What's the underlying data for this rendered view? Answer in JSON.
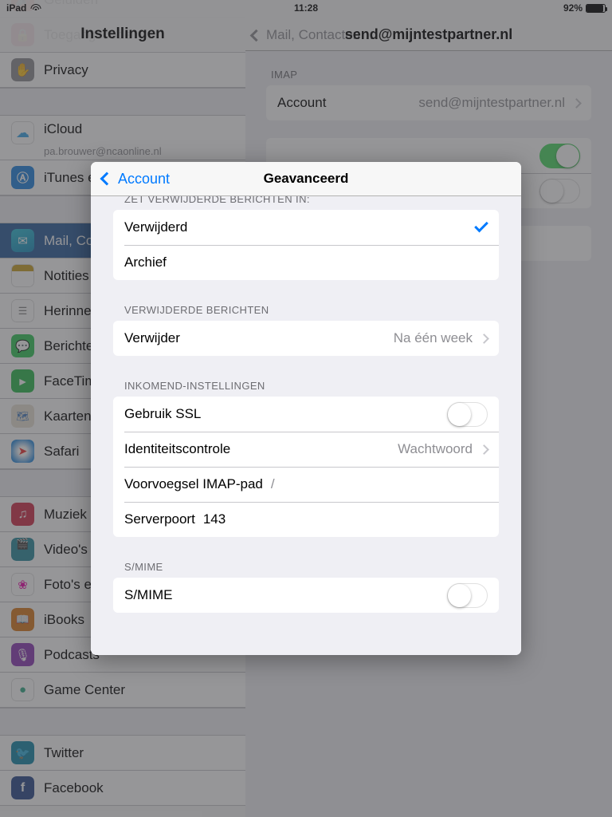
{
  "statusbar": {
    "device": "iPad",
    "wifi_icon": "wifi-icon",
    "time": "11:28",
    "battery_percent": "92%",
    "battery_icon": "battery-icon"
  },
  "sidebar": {
    "nav_title": "Instellingen",
    "items": [
      {
        "label": "Geluiden",
        "icon": "speaker-icon",
        "color": "#ef4a3c",
        "selected": false,
        "partial": true
      },
      {
        "label": "Toegangscode",
        "icon": "lock-icon",
        "color": "#c9233f",
        "selected": false
      },
      {
        "label": "Privacy",
        "icon": "hand-icon",
        "color": "#8e8e93",
        "selected": false
      },
      {
        "label": "iCloud",
        "sublabel": "pa.brouwer@ncaonline.nl",
        "icon": "icloud-icon",
        "color": "#3aa6e8",
        "selected": false
      },
      {
        "label": "iTunes en App Store",
        "icon": "appstore-icon",
        "color": "#1f84e0",
        "selected": false
      },
      {
        "label": "Mail, Contacten, Agenda",
        "icon": "mail-icon",
        "color": "#1aa9d6",
        "selected": true
      },
      {
        "label": "Notities",
        "icon": "notes-icon",
        "color": "#f2e8b0",
        "selected": false
      },
      {
        "label": "Herinneringen",
        "icon": "reminders-icon",
        "color": "#ffffff",
        "selected": false
      },
      {
        "label": "Berichten",
        "icon": "messages-icon",
        "color": "#34c759",
        "selected": false
      },
      {
        "label": "FaceTime",
        "icon": "facetime-icon",
        "color": "#2dbb4e",
        "selected": false
      },
      {
        "label": "Kaarten",
        "icon": "maps-icon",
        "color": "#e8e2d5",
        "selected": false
      },
      {
        "label": "Safari",
        "icon": "safari-icon",
        "color": "#2f8fe0",
        "selected": false
      },
      {
        "label": "Muziek",
        "icon": "music-icon",
        "color": "#d12f4a",
        "selected": false
      },
      {
        "label": "Video's",
        "icon": "videos-icon",
        "color": "#2a8c9e",
        "selected": false
      },
      {
        "label": "Foto's en Camera",
        "icon": "photos-icon",
        "color": "#ffffff",
        "selected": false
      },
      {
        "label": "iBooks",
        "icon": "ibooks-icon",
        "color": "#d97b1e",
        "selected": false
      },
      {
        "label": "Podcasts",
        "icon": "podcasts-icon",
        "color": "#8d3ab5",
        "selected": false
      },
      {
        "label": "Game Center",
        "icon": "gamecenter-icon",
        "color": "#ffffff",
        "selected": false
      },
      {
        "label": "Twitter",
        "icon": "twitter-icon",
        "color": "#1587a8",
        "selected": false
      },
      {
        "label": "Facebook",
        "icon": "facebook-icon",
        "color": "#2c4b8c",
        "selected": false
      }
    ]
  },
  "detail": {
    "back_label": "Mail, Contacten…",
    "title": "send@mijntestpartner.nl",
    "group_header": "IMAP",
    "account_row": {
      "label": "Account",
      "value": "send@mijntestpartner.nl",
      "chevron": "chevron-right-icon"
    },
    "toggle_rows": [
      {
        "label": "",
        "state": "on"
      },
      {
        "label": "",
        "state": "off"
      }
    ]
  },
  "modal": {
    "back_label": "Account",
    "title": "Geavanceerd",
    "sections": [
      {
        "header": "ZET VERWIJDERDE BERICHTEN IN:",
        "rows": [
          {
            "label": "Verwijderd",
            "checked": true
          },
          {
            "label": "Archief",
            "checked": false
          }
        ]
      },
      {
        "header": "VERWIJDERDE BERICHTEN",
        "rows": [
          {
            "label": "Verwijder",
            "value": "Na één week",
            "chevron": "chevron-right-icon"
          }
        ]
      },
      {
        "header": "INKOMEND-INSTELLINGEN",
        "rows": [
          {
            "label": "Gebruik SSL",
            "toggle": "off"
          },
          {
            "label": "Identiteitscontrole",
            "value": "Wachtwoord",
            "chevron": "chevron-right-icon"
          },
          {
            "label": "Voorvoegsel IMAP-pad",
            "inline_value": "/"
          },
          {
            "label": "Serverpoort",
            "inline_value": "143"
          }
        ]
      },
      {
        "header": "S/MIME",
        "rows": [
          {
            "label": "S/MIME",
            "toggle": "off"
          }
        ]
      }
    ]
  },
  "colors": {
    "accent_blue": "#007aff",
    "toggle_green": "#4cd964",
    "header_gray": "#6d6d72",
    "value_gray": "#8e8e93",
    "group_bg": "#efeff4"
  }
}
